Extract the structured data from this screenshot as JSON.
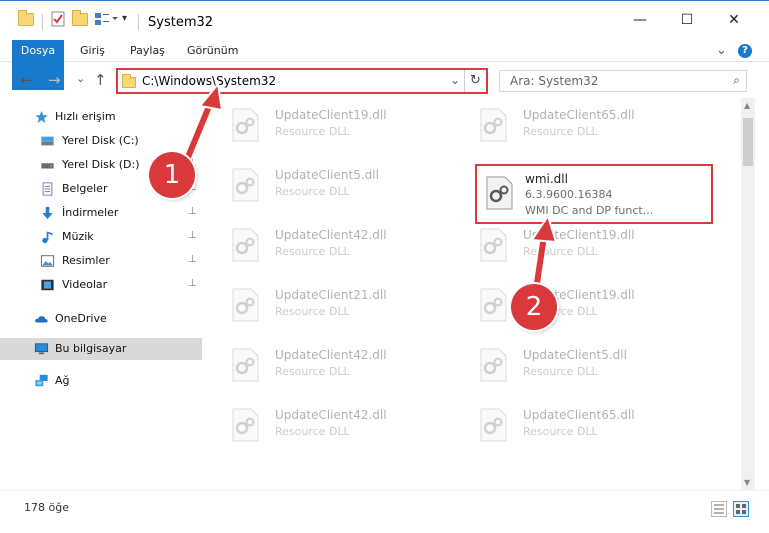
{
  "window": {
    "title": "System32",
    "minimize": "—",
    "maximize": "☐",
    "close": "✕"
  },
  "ribbon": {
    "tabs": [
      {
        "label": "Dosya"
      },
      {
        "label": "Giriş"
      },
      {
        "label": "Paylaş"
      },
      {
        "label": "Görünüm"
      }
    ],
    "expand": "⌄",
    "help": "?"
  },
  "address": {
    "path": "C:\\Windows\\System32",
    "chevron": "⌄",
    "refresh": "↻"
  },
  "search": {
    "placeholder": "Ara: System32",
    "icon": "⌕"
  },
  "nav": {
    "back": "←",
    "forward": "→",
    "recent": "⌄",
    "up": "↑"
  },
  "sidebar": {
    "items": [
      {
        "label": "Hızlı erişim",
        "icon": "star-icon"
      },
      {
        "label": "Yerel Disk (C:)",
        "icon": "drive-icon"
      },
      {
        "label": "Yerel Disk (D:)",
        "icon": "drive-icon"
      },
      {
        "label": "Belgeler",
        "icon": "documents-icon"
      },
      {
        "label": "İndirmeler",
        "icon": "download-icon"
      },
      {
        "label": "Müzik",
        "icon": "music-icon"
      },
      {
        "label": "Resimler",
        "icon": "pictures-icon"
      },
      {
        "label": "Videolar",
        "icon": "videos-icon"
      },
      {
        "label": "OneDrive",
        "icon": "cloud-icon"
      },
      {
        "label": "Bu bilgisayar",
        "icon": "computer-icon"
      },
      {
        "label": "Ağ",
        "icon": "network-icon"
      }
    ],
    "pin": "📌"
  },
  "files": [
    {
      "name": "UpdateClient19.dll",
      "desc": "Resource DLL"
    },
    {
      "name": "UpdateClient65.dll",
      "desc": "Resource DLL"
    },
    {
      "name": "UpdateClient5.dll",
      "desc": "Resource DLL"
    },
    {
      "name": "wmi.dll",
      "desc": "6.3.9600.16384",
      "desc2": "WMI DC and DP funct..."
    },
    {
      "name": "UpdateClient42.dll",
      "desc": "Resource DLL"
    },
    {
      "name": "UpdateClient19.dll",
      "desc": "Resource DLL"
    },
    {
      "name": "UpdateClient21.dll",
      "desc": "Resource DLL"
    },
    {
      "name": "UpdateClient19.dll",
      "desc": "Resource DLL"
    },
    {
      "name": "UpdateClient42.dll",
      "desc": "Resource DLL"
    },
    {
      "name": "UpdateClient5.dll",
      "desc": "Resource DLL"
    },
    {
      "name": "UpdateClient42.dll",
      "desc": "Resource DLL"
    },
    {
      "name": "UpdateClient65.dll",
      "desc": "Resource DLL"
    }
  ],
  "status": {
    "count": "178 öğe"
  },
  "annotations": {
    "step1": "1",
    "step2": "2"
  },
  "colors": {
    "accent": "#1979ca",
    "highlight": "#d9393a"
  }
}
